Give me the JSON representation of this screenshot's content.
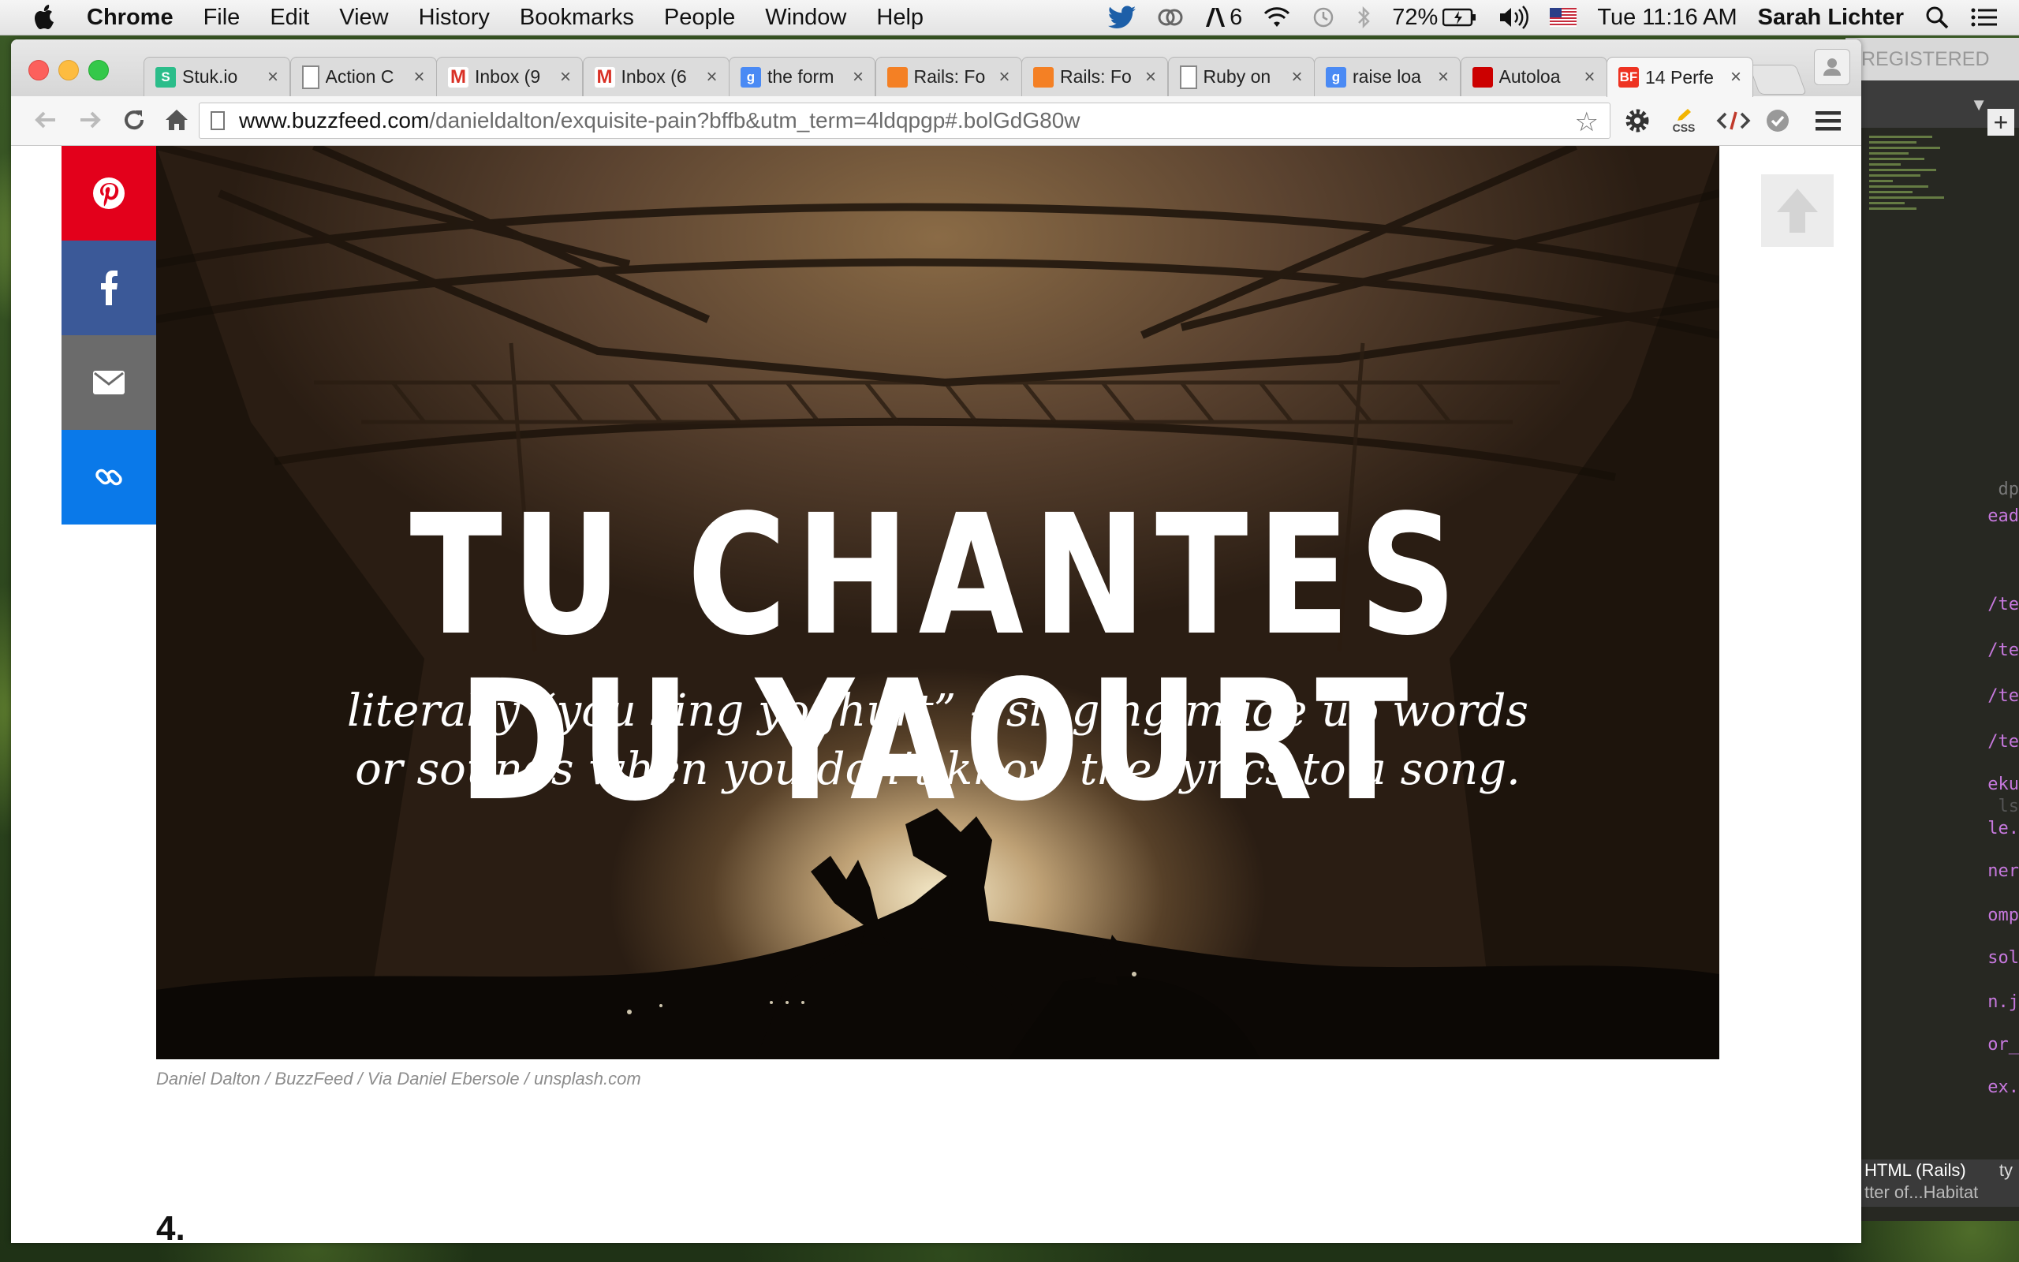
{
  "menubar": {
    "app": "Chrome",
    "items": [
      "File",
      "Edit",
      "View",
      "History",
      "Bookmarks",
      "People",
      "Window",
      "Help"
    ],
    "adobe_count": "6",
    "battery": "72%",
    "clock": "Tue 11:16 AM",
    "user": "Sarah Lichter"
  },
  "tabs": [
    {
      "title": "Stuk.io",
      "fav_text": "S",
      "fav_color": "#2bbd8a"
    },
    {
      "title": "Action C",
      "fav_text": "",
      "fav_color": "#ffffff"
    },
    {
      "title": "Inbox (9",
      "fav_text": "M",
      "fav_color": "#ffffff"
    },
    {
      "title": "Inbox (6",
      "fav_text": "M",
      "fav_color": "#ffffff"
    },
    {
      "title": "the form",
      "fav_text": "g",
      "fav_color": "#4a8af4"
    },
    {
      "title": "Rails: Fo",
      "fav_text": "",
      "fav_color": "#f48024"
    },
    {
      "title": "Rails: Fo",
      "fav_text": "",
      "fav_color": "#f48024"
    },
    {
      "title": "Ruby on",
      "fav_text": "",
      "fav_color": "#ffffff"
    },
    {
      "title": "raise loa",
      "fav_text": "g",
      "fav_color": "#4a8af4"
    },
    {
      "title": "Autoloa",
      "fav_text": "",
      "fav_color": "#cc0000"
    },
    {
      "title": "14 Perfe",
      "fav_text": "BF",
      "fav_color": "#ee3322"
    }
  ],
  "address": {
    "domain": "www.buzzfeed.com",
    "path": "/danieldalton/exquisite-pain?bffb&utm_term=4ldqpgp#.bolGdG80w"
  },
  "extensions": {
    "css_label": "CSS"
  },
  "editor": {
    "header": "REGISTERED",
    "status_label": "HTML (Rails)",
    "status_file": "tter of...Habitat",
    "status_suffix": "ty",
    "gutter": [
      "dp",
      "ead",
      "/te",
      "/te",
      "/te",
      "/te",
      "eku",
      "ls",
      "le.",
      "ner",
      "omp",
      "sol",
      "n.j",
      "or_",
      "ex."
    ]
  },
  "article": {
    "hero_title": "TU CHANTES DU YAOURT",
    "hero_subtitle_line1": "literally “you sing yoghurt” –  singing made up words",
    "hero_subtitle_line2": "or sounds when you don’t know the lyrics to a song.",
    "caption": "Daniel Dalton / BuzzFeed / Via Daniel Ebersole / unsplash.com",
    "next_item_number": "4."
  },
  "share": {
    "pinterest_color": "#e3001b",
    "facebook_color": "#3b5998",
    "email_color": "#6b6b6b",
    "link_color": "#0a79e9"
  }
}
